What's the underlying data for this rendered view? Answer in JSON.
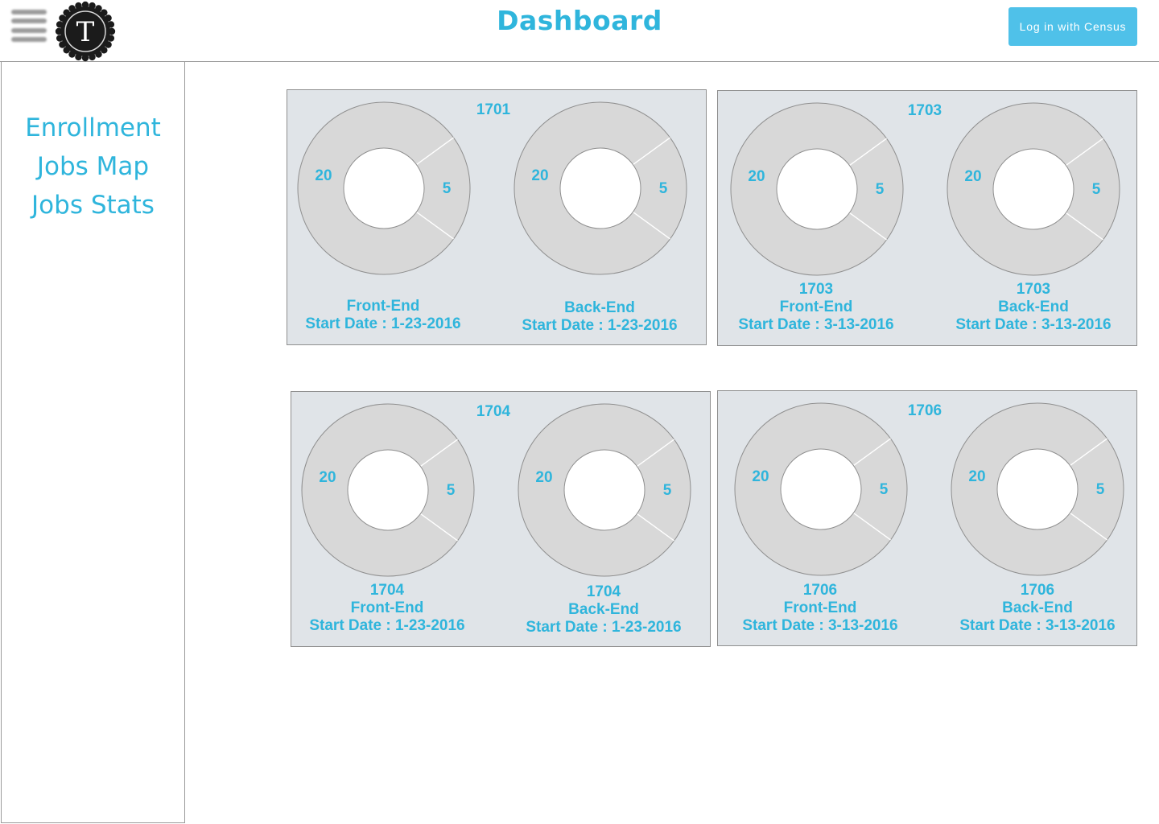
{
  "header": {
    "menu_icon": "hamburger-menu-icon",
    "logo_letter": "T",
    "title": "Dashboard",
    "login_label": "Log in with Census",
    "accent_color": "#2fb5dc",
    "button_color": "#4fc1e9"
  },
  "sidebar": {
    "items": [
      {
        "label": "Enrollment"
      },
      {
        "label": "Jobs Map"
      },
      {
        "label": "Jobs Stats"
      }
    ]
  },
  "panels": [
    {
      "title": "1701",
      "charts": [
        {
          "cohort": "",
          "track": "Front-End",
          "start": "Start Date : 1-23-2016",
          "value_large": "20",
          "value_small": "5"
        },
        {
          "cohort": "",
          "track": "Back-End",
          "start": "Start Date : 1-23-2016",
          "value_large": "20",
          "value_small": "5"
        }
      ]
    },
    {
      "title": "1703",
      "charts": [
        {
          "cohort": "1703",
          "track": "Front-End",
          "start": "Start Date : 3-13-2016",
          "value_large": "20",
          "value_small": "5"
        },
        {
          "cohort": "1703",
          "track": "Back-End",
          "start": "Start Date : 3-13-2016",
          "value_large": "20",
          "value_small": "5"
        }
      ]
    },
    {
      "title": "1704",
      "charts": [
        {
          "cohort": "1704",
          "track": "Front-End",
          "start": "Start Date : 1-23-2016",
          "value_large": "20",
          "value_small": "5"
        },
        {
          "cohort": "1704",
          "track": "Back-End",
          "start": "Start Date : 1-23-2016",
          "value_large": "20",
          "value_small": "5"
        }
      ]
    },
    {
      "title": "1706",
      "charts": [
        {
          "cohort": "1706",
          "track": "Front-End",
          "start": "Start Date : 3-13-2016",
          "value_large": "20",
          "value_small": "5"
        },
        {
          "cohort": "1706",
          "track": "Back-End",
          "start": "Start Date : 3-13-2016",
          "value_large": "20",
          "value_small": "5"
        }
      ]
    }
  ]
}
